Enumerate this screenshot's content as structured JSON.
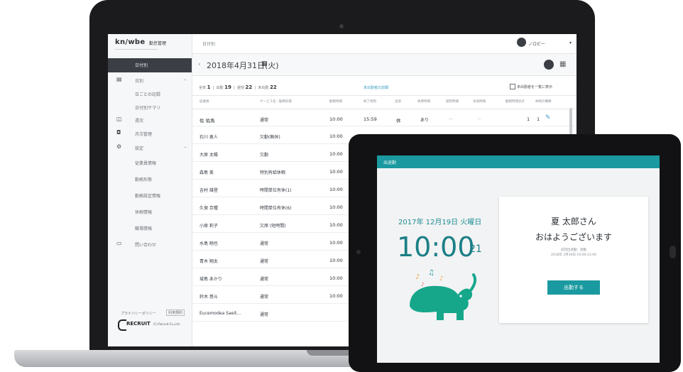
{
  "laptop": {
    "logo": "kn/wbe",
    "logo_sub": "勤怠管理",
    "breadcrumb": "日付別",
    "user": {
      "name": "ノロビー",
      "caret": "▾"
    },
    "sidebar": {
      "active_label": "日付別",
      "items": [
        {
          "icon": "▤",
          "label": "日別",
          "chevron": "",
          "indent": false
        },
        {
          "icon": "",
          "label": "日ごとの記録",
          "indent": true
        },
        {
          "icon": "",
          "label": "日付別サマリ",
          "indent": true
        },
        {
          "icon": "◫",
          "label": "週次",
          "indent": false
        },
        {
          "icon": "◘",
          "label": "月次管理",
          "indent": false
        },
        {
          "icon": "⚙",
          "label": "設定",
          "indent": false
        },
        {
          "icon": "",
          "label": "従業員情報",
          "indent": true
        },
        {
          "icon": "",
          "label": "勤務形態",
          "indent": true
        },
        {
          "icon": "",
          "label": "勤務設定情報",
          "indent": true
        },
        {
          "icon": "",
          "label": "休暇情報",
          "indent": true
        },
        {
          "icon": "",
          "label": "職場情報",
          "indent": true
        },
        {
          "icon": "▭",
          "label": "問い合わせ",
          "indent": false
        }
      ],
      "footer_link": "プライバシーポリシー",
      "footer_button": "利用規約",
      "brand": "RECRUIT",
      "brand_sub": "(C) Recruit Co.,Ltd."
    },
    "date_bar": {
      "prev": "‹",
      "date": "2018年4月31日(火)",
      "calendar": "▦",
      "next": "›",
      "grid_icon": "▦"
    },
    "summary": {
      "label_all": "全体",
      "all": "1",
      "label_in": "出勤",
      "in_count": "19",
      "label_late": "遅刻",
      "late": "22",
      "label_absent": "未出勤",
      "absent": "22",
      "link": "未出勤者の詳細",
      "checkbox_label": "未出勤者を一覧に表示"
    },
    "columns": [
      "従業員",
      "サービス名・勤務形態",
      "勤務時間",
      "終了時刻",
      "出退",
      "休憩時間",
      "遅刻時間",
      "早退時間",
      "勤務時間合計",
      "休暇の種類"
    ],
    "rows": [
      {
        "name": "佐 佑馬",
        "type": "通常",
        "start": "10:00",
        "end": "15:59",
        "status": "休",
        "break": "あり",
        "late": "—",
        "early": "—",
        "total": "1",
        "extra": "1"
      },
      {
        "name": "石川 恵人",
        "type": "欠勤(無休)",
        "start": "10:00"
      },
      {
        "name": "大原 太陽",
        "type": "欠勤",
        "start": "10:00"
      },
      {
        "name": "森島 美",
        "type": "特別有給休暇",
        "start": "10:00"
      },
      {
        "name": "吉村 雄登",
        "type": "時間単位有休(1)",
        "start": "10:00"
      },
      {
        "name": "久保 京種",
        "type": "時間単位有休(6)",
        "start": "10:00"
      },
      {
        "name": "小原 莉子",
        "type": "欠席 (短時間)",
        "start": "10:00"
      },
      {
        "name": "水島 翔也",
        "type": "通常",
        "start": "10:00"
      },
      {
        "name": "青木 翔太",
        "type": "通常",
        "start": "10:00"
      },
      {
        "name": "城島 あかり",
        "type": "通常",
        "start": "10:00"
      },
      {
        "name": "鈴木 悠斗",
        "type": "通常",
        "start": "10:00"
      },
      {
        "name": "Eucemodea Saeit...",
        "type": "通常",
        "start": ""
      }
    ]
  },
  "tablet": {
    "header": "出退勤",
    "date": "2017年 12月19日 火曜日",
    "time": "10:00",
    "seconds": "21",
    "greeting_name": "夏 太郎さん",
    "greeting_message": "おはようございます",
    "sub_line_1": "前回出退勤：退勤",
    "sub_line_2": "2018年 3月30日 19:00-21:00",
    "clock_in_button": "出勤する",
    "colors": {
      "accent": "#1a9aa0",
      "elephant": "#16a78b",
      "notes": "#f3a23a"
    }
  }
}
